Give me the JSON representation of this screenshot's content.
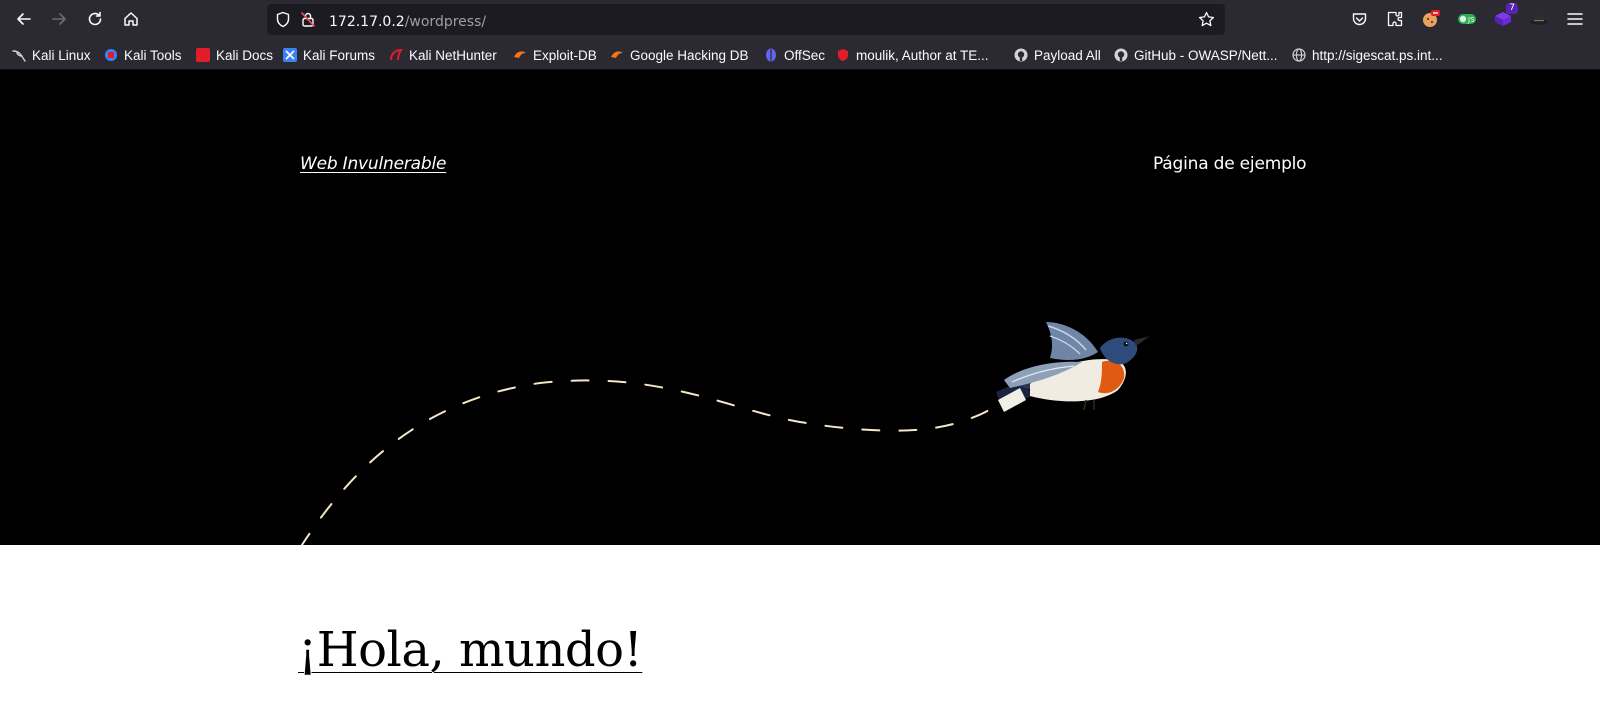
{
  "browser": {
    "url_host": "172.17.0.2",
    "url_path": "/wordpress/",
    "icons": {
      "back": "back-arrow-icon",
      "forward": "forward-arrow-icon",
      "reload": "reload-icon",
      "home": "home-icon",
      "shield": "tracking-protection-icon",
      "lock": "insecure-lock-icon",
      "star": "bookmark-star-icon"
    },
    "extensions": [
      {
        "name": "pocket-icon",
        "badge": ""
      },
      {
        "name": "extensions-icon",
        "badge": ""
      },
      {
        "name": "cookie-extension-icon",
        "badge": ""
      },
      {
        "name": "green-toggle-extension-icon",
        "badge": ""
      },
      {
        "name": "purple-extension-icon",
        "badge": "7"
      },
      {
        "name": "hat-extension-icon",
        "badge": ""
      },
      {
        "name": "hamburger-menu-icon",
        "badge": ""
      }
    ],
    "bookmarks": [
      {
        "label": "Kali Linux",
        "icon": "kali-dragon-icon",
        "color": "#c7c7c7"
      },
      {
        "label": "Kali Tools",
        "icon": "kali-tools-icon",
        "color": "#3b82f6"
      },
      {
        "label": "Kali Docs",
        "icon": "kali-docs-icon",
        "color": "#e11d2a"
      },
      {
        "label": "Kali Forums",
        "icon": "kali-forums-icon",
        "color": "#3b82f6"
      },
      {
        "label": "Kali NetHunter",
        "icon": "nethunter-icon",
        "color": "#e11d2a"
      },
      {
        "label": "Exploit-DB",
        "icon": "exploit-db-icon",
        "color": "#f97316"
      },
      {
        "label": "Google Hacking DB",
        "icon": "ghdb-icon",
        "color": "#f97316"
      },
      {
        "label": "OffSec",
        "icon": "offsec-icon",
        "color": "#6366f1"
      },
      {
        "label": "moulik, Author at TE...",
        "icon": "te-shield-icon",
        "color": "#e11d2a"
      },
      {
        "label": "Payload All",
        "icon": "github-icon",
        "color": "#d4d4d4"
      },
      {
        "label": "GitHub - OWASP/Nett...",
        "icon": "github-icon",
        "color": "#d4d4d4"
      },
      {
        "label": "http://sigescat.ps.int...",
        "icon": "globe-icon",
        "color": "#d4d4d4"
      }
    ]
  },
  "site": {
    "title": "Web Invulnerable",
    "menu_item": "Página de ejemplo"
  },
  "post": {
    "title": "¡Hola, mundo!"
  },
  "colors": {
    "chrome": "#2b2a33",
    "urlbar": "#1c1b22",
    "hero": "#000000",
    "path_dash": "#f5e6c8",
    "bird_breast": "#e05a12"
  }
}
